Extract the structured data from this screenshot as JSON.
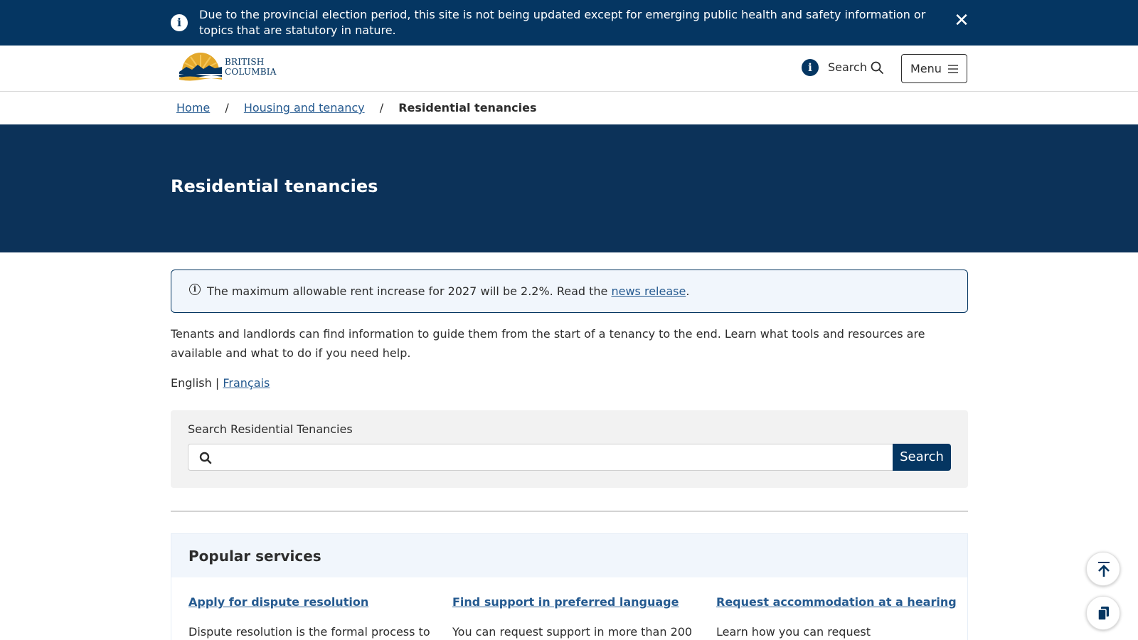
{
  "alert": {
    "text": "Due to the provincial election period, this site is not being updated except for emerging public health and safety information or topics that are statutory in nature.",
    "info_glyph": "i",
    "close_glyph": "✕"
  },
  "header": {
    "logo_line1": "British",
    "logo_line2": "Columbia",
    "info_glyph": "i",
    "search_label": "Search",
    "menu_label": "Menu"
  },
  "breadcrumb": {
    "items": [
      "Home",
      "Housing and tenancy"
    ],
    "separator": "/",
    "current": "Residential tenancies"
  },
  "hero": {
    "title": "Residential tenancies"
  },
  "notice": {
    "glyph": "i",
    "text_before": "The maximum allowable rent increase for 2027 will be 2.2%. Read the ",
    "link": "news release",
    "text_after": "."
  },
  "intro": "Tenants and landlords can find information to guide them from the start of a tenancy to the end. Learn what tools and resources are available and what to do if you need help.",
  "language": {
    "current": "English",
    "separator": "|",
    "alternate": "Français"
  },
  "search_panel": {
    "label": "Search Residential Tenancies",
    "value": "",
    "placeholder": "",
    "button": "Search"
  },
  "popular": {
    "title": "Popular services",
    "items": [
      {
        "link": "Apply for dispute resolution",
        "desc": "Dispute resolution is the formal process to"
      },
      {
        "link": "Find support in preferred language",
        "desc": "You can request support in more than 200"
      },
      {
        "link": "Request accommodation at a hearing",
        "desc": "Learn how you can request"
      }
    ]
  },
  "colors": {
    "navy": "#053662",
    "hero": "#0c3259",
    "link": "#255a90",
    "notice_bg": "#f1f6fc",
    "gold": "#e3a82b"
  },
  "icons": [
    "info-icon",
    "close-icon",
    "bc-logo",
    "search-icon",
    "hamburger-icon",
    "back-to-top-icon",
    "copy-icon"
  ]
}
